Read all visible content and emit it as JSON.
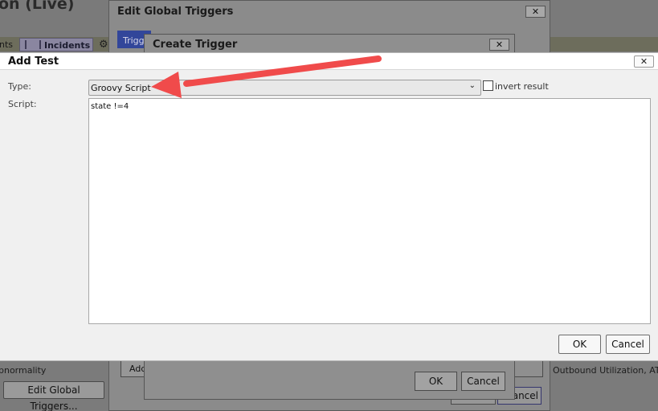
{
  "background_app": {
    "title_fragment": "on (Live)",
    "tab_fragment": "nts",
    "incidents_tab": "Incidents",
    "abnormality_text": "bnormality",
    "edit_global_triggers_button": "Edit Global Triggers...",
    "outbound_text": "v Outbound Utilization, ATM"
  },
  "edit_global_triggers_dialog": {
    "title": "Edit Global Triggers",
    "close_label": "✕",
    "triggers_tab": "Trigg",
    "add_button": "Add",
    "cancel_button": "ancel"
  },
  "create_trigger_dialog": {
    "title": "Create Trigger",
    "close_label": "✕",
    "ok_button": "OK",
    "cancel_button": "Cancel"
  },
  "add_test_dialog": {
    "title": "Add Test",
    "close_label": "✕",
    "type_label": "Type:",
    "type_value": "Groovy Script",
    "invert_label": "invert result",
    "invert_checked": false,
    "script_label": "Script:",
    "script_value": "state !=4",
    "ok_button": "OK",
    "cancel_button": "Cancel"
  },
  "annotation": {
    "arrow_color": "#f04b4b"
  }
}
